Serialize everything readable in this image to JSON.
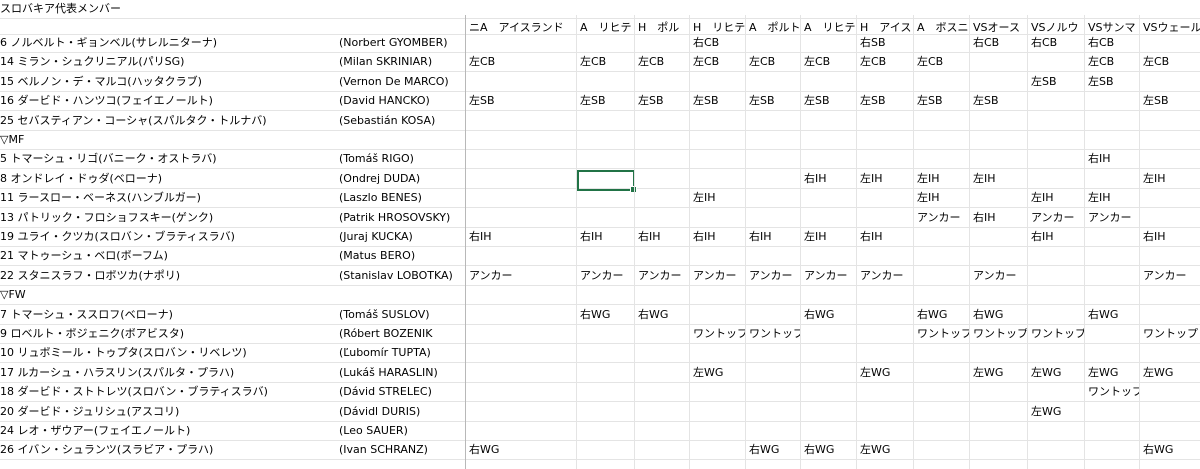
{
  "sheet_title": "スロバキア代表メンバー",
  "match_headers": [
    "ニA　アイスランド",
    "A　リヒテ",
    "H　ポル",
    "H　リヒテ",
    "A　ポルト",
    "A　リヒテ",
    "H　アイス",
    "A　ボスニ",
    "VSオース",
    "VSノルウ",
    "VSサンマ",
    "VSウェール"
  ],
  "rows": [
    {
      "kind": "player",
      "name": "6 ノルベルト・ギョンベル(サレルニターナ)",
      "eng": "(Norbert GYOMBER)",
      "cells": [
        "",
        "",
        "",
        "右CB",
        "",
        "",
        "右SB",
        "",
        "右CB",
        "右CB",
        "右CB",
        ""
      ]
    },
    {
      "kind": "player",
      "name": "14 ミラン・シュクリニアル(パリSG)",
      "eng": "(Milan SKRINIAR)",
      "cells": [
        "左CB",
        "左CB",
        "左CB",
        "左CB",
        "左CB",
        "左CB",
        "左CB",
        "左CB",
        "",
        "",
        "左CB",
        "左CB"
      ]
    },
    {
      "kind": "player",
      "name": "15 ベルノン・デ・マルコ(ハッタクラブ)",
      "eng": "(Vernon De MARCO)",
      "cells": [
        "",
        "",
        "",
        "",
        "",
        "",
        "",
        "",
        "",
        "左SB",
        "左SB",
        ""
      ]
    },
    {
      "kind": "player",
      "name": "16 ダービド・ハンツコ(フェイエノールト)",
      "eng": "(David HANCKO)",
      "cells": [
        "左SB",
        "左SB",
        "左SB",
        "左SB",
        "左SB",
        "左SB",
        "左SB",
        "左SB",
        "左SB",
        "",
        "",
        "左SB"
      ]
    },
    {
      "kind": "player",
      "name": "25 セバスティアン・コーシャ(スパルタク・トルナバ)",
      "eng": "(Sebastián KOSA)",
      "cells": [
        "",
        "",
        "",
        "",
        "",
        "",
        "",
        "",
        "",
        "",
        "",
        ""
      ]
    },
    {
      "kind": "section",
      "name": "▽MF"
    },
    {
      "kind": "player",
      "name": "5 トマーシュ・リゴ(バニーク・オストラバ)",
      "eng": "(Tomáš RIGO)",
      "cells": [
        "",
        "",
        "",
        "",
        "",
        "",
        "",
        "",
        "",
        "",
        "右IH",
        ""
      ]
    },
    {
      "kind": "player",
      "name": "8 オンドレイ・ドゥダ(ベローナ)",
      "eng": "(Ondrej DUDA)",
      "cells": [
        "",
        "",
        "",
        "",
        "",
        "右IH",
        "左IH",
        "左IH",
        "左IH",
        "",
        "",
        "左IH"
      ]
    },
    {
      "kind": "player",
      "name": "11 ラースロー・ベーネス(ハンブルガー)",
      "eng": "(Laszlo BENES)",
      "cells": [
        "",
        "",
        "",
        "左IH",
        "",
        "",
        "",
        "左IH",
        "",
        "左IH",
        "左IH",
        ""
      ]
    },
    {
      "kind": "player",
      "name": "13 パトリック・フロショフスキー(ゲンク)",
      "eng": "(Patrik HROSOVSKY)",
      "cells": [
        "",
        "",
        "",
        "",
        "",
        "",
        "",
        "アンカー",
        "右IH",
        "アンカー",
        "アンカー",
        ""
      ]
    },
    {
      "kind": "player",
      "name": "19 ユライ・クツカ(スロバン・ブラティスラバ)",
      "eng": "(Juraj KUCKA)",
      "cells": [
        "右IH",
        "右IH",
        "右IH",
        "右IH",
        "右IH",
        "左IH",
        "右IH",
        "",
        "",
        "右IH",
        "",
        "右IH"
      ]
    },
    {
      "kind": "player",
      "name": "21 マトゥーシュ・ベロ(ボーフム)",
      "eng": "(Matus BERO)",
      "cells": [
        "",
        "",
        "",
        "",
        "",
        "",
        "",
        "",
        "",
        "",
        "",
        ""
      ]
    },
    {
      "kind": "player",
      "name": "22 スタニスラフ・ロボツカ(ナポリ)",
      "eng": "(Stanislav LOBOTKA)",
      "cells": [
        "アンカー",
        "アンカー",
        "アンカー",
        "アンカー",
        "アンカー",
        "アンカー",
        "アンカー",
        "",
        "アンカー",
        "",
        "",
        "アンカー"
      ]
    },
    {
      "kind": "section",
      "name": "▽FW"
    },
    {
      "kind": "player",
      "name": "7 トマーシュ・ススロフ(ベローナ)",
      "eng": "(Tomáš SUSLOV)",
      "cells": [
        "",
        "右WG",
        "右WG",
        "",
        "",
        "右WG",
        "",
        "右WG",
        "右WG",
        "",
        "右WG",
        ""
      ]
    },
    {
      "kind": "player",
      "name": "9 ロベルト・ボジェニク(ボアビスタ)",
      "eng": "(Róbert BOZENIK",
      "cells": [
        "",
        "",
        "",
        "ワントップ",
        "ワントップ",
        "",
        "",
        "ワントップ",
        "ワントップ",
        "ワントップ",
        "",
        "ワントップ"
      ]
    },
    {
      "kind": "player",
      "name": "10 リュボミール・トゥプタ(スロバン・リベレツ)",
      "eng": "(Ľubomír TUPTA)",
      "cells": [
        "",
        "",
        "",
        "",
        "",
        "",
        "",
        "",
        "",
        "",
        "",
        ""
      ]
    },
    {
      "kind": "player",
      "name": "17 ルカーシュ・ハラスリン(スパルタ・プラハ)",
      "eng": "(Lukáš HARASLIN)",
      "cells": [
        "",
        "",
        "",
        "左WG",
        "",
        "",
        "左WG",
        "",
        "左WG",
        "左WG",
        "左WG",
        "左WG"
      ]
    },
    {
      "kind": "player",
      "name": "18 ダービド・ストトレツ(スロバン・ブラティスラバ)",
      "eng": "(Dávid STRELEC)",
      "cells": [
        "",
        "",
        "",
        "",
        "",
        "",
        "",
        "",
        "",
        "",
        "ワントップ",
        ""
      ]
    },
    {
      "kind": "player",
      "name": "20 ダービド・ジュリシュ(アスコリ)",
      "eng": "(Dávidl DURIS)",
      "cells": [
        "",
        "",
        "",
        "",
        "",
        "",
        "",
        "",
        "",
        "左WG",
        "",
        ""
      ]
    },
    {
      "kind": "player",
      "name": "24 レオ・ザウアー(フェイエノールト)",
      "eng": "(Leo SAUER)",
      "cells": [
        "",
        "",
        "",
        "",
        "",
        "",
        "",
        "",
        "",
        "",
        "",
        ""
      ]
    },
    {
      "kind": "player",
      "name": "26 イバン・シュランツ(スラビア・プラハ)",
      "eng": "(Ivan SCHRANZ)",
      "cells": [
        "右WG",
        "",
        "",
        "",
        "右WG",
        "右WG",
        "左WG",
        "",
        "",
        "",
        "",
        "右WG"
      ]
    }
  ]
}
